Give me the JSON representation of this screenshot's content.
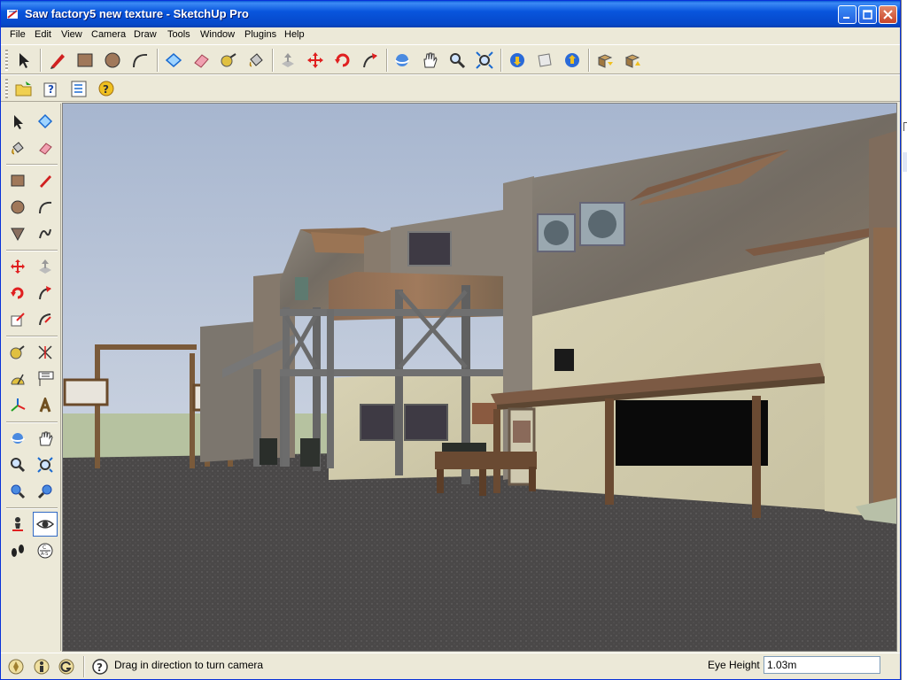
{
  "window": {
    "title": "Saw factory5 new texture - SketchUp Pro",
    "controls": [
      "minimize",
      "maximize",
      "close"
    ]
  },
  "menu": [
    "File",
    "Edit",
    "View",
    "Camera",
    "Draw",
    "Tools",
    "Window",
    "Plugins",
    "Help"
  ],
  "toolbar_top": [
    "select-icon",
    "pencil-icon",
    "rectangle-icon",
    "circle-icon",
    "arc-icon",
    "make-component-icon",
    "eraser-icon",
    "tape-measure-icon",
    "paint-bucket-icon",
    "push-pull-icon",
    "move-icon",
    "rotate-icon",
    "follow-me-icon",
    "orbit-icon",
    "pan-icon",
    "zoom-icon",
    "zoom-extents-icon",
    "3d-warehouse-icon",
    "share-model-icon",
    "get-models-icon",
    "get-component-icon",
    "share-component-icon"
  ],
  "toolbar_second": [
    "open-folder-icon",
    "question-icon",
    "checklist-icon",
    "help-icon"
  ],
  "left_palette": [
    "select-icon",
    "make-component-icon",
    "paint-bucket-icon",
    "eraser-icon",
    "rectangle-icon",
    "line-icon",
    "circle-icon",
    "arc-icon",
    "polygon-icon",
    "freehand-icon",
    "move-icon",
    "push-pull-icon",
    "rotate-icon",
    "follow-me-icon",
    "scale-icon",
    "offset-icon",
    "tape-measure-icon",
    "dimension-icon",
    "protractor-icon",
    "text-icon",
    "axes-icon",
    "3d-text-icon",
    "orbit-icon",
    "pan-icon",
    "zoom-icon",
    "zoom-window-icon",
    "previous-view-icon",
    "next-view-icon",
    "position-camera-icon",
    "look-around-icon",
    "walk-icon",
    "section-plane-icon"
  ],
  "status": {
    "icons": [
      "geo-location-icon",
      "credits-icon",
      "sign-in-icon"
    ],
    "help_icon": "help-icon",
    "message": "Drag in direction to turn camera",
    "measure_label": "Eye Height",
    "measure_value": "1.03m"
  },
  "colors": {
    "titlebar": "#0855dd",
    "chrome": "#ece9d8",
    "sky": "#b8c4d8",
    "ground": "#4a4848"
  }
}
